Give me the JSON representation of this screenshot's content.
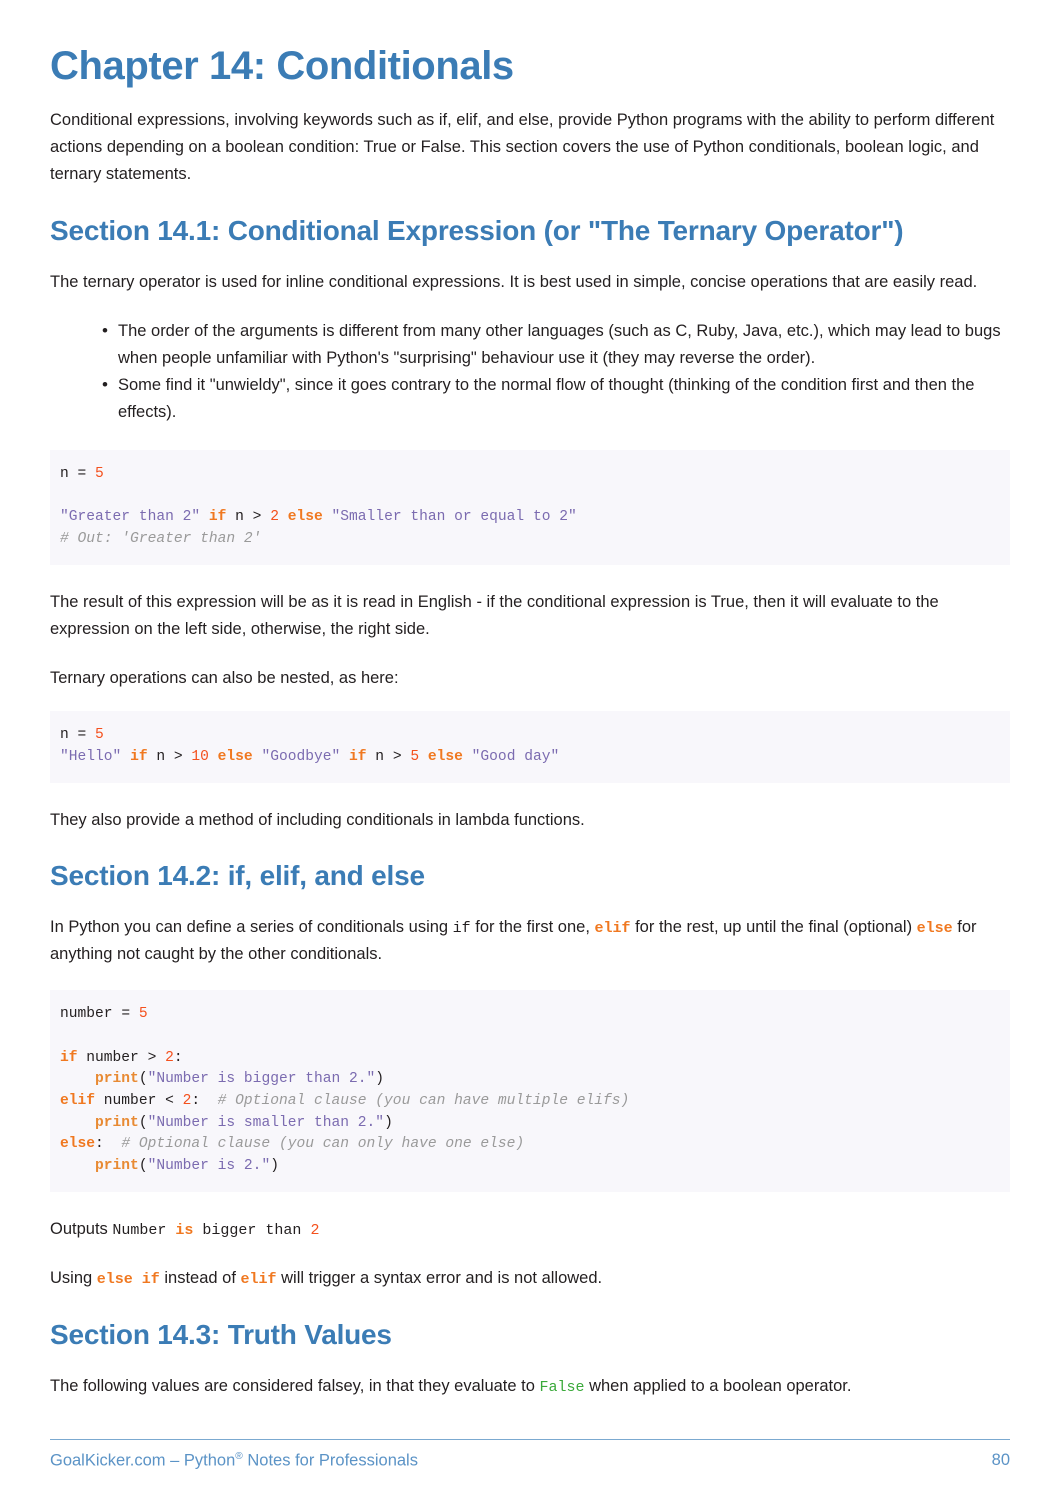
{
  "chapter": {
    "title": "Chapter 14: Conditionals",
    "intro": "Conditional expressions, involving keywords such as if, elif, and else, provide Python programs with the ability to perform different actions depending on a boolean condition: True or False. This section covers the use of Python conditionals, boolean logic, and ternary statements."
  },
  "section_141": {
    "heading": "Section 14.1: Conditional Expression (or \"The Ternary Operator\")",
    "para_1": "The ternary operator is used for inline conditional expressions. It is best used in simple, concise operations that are easily read.",
    "bullets": [
      "The order of the arguments is different from many other languages (such as C, Ruby, Java, etc.), which may lead to bugs when people unfamiliar with Python's \"surprising\" behaviour use it (they may reverse the order).",
      "Some find it \"unwieldy\", since it goes contrary to the normal flow of thought (thinking of the condition first and then the effects)."
    ],
    "code_1": {
      "line_1_var": "n ",
      "line_1_eq": "= ",
      "line_1_num": "5",
      "line_3_str1": "\"Greater than 2\" ",
      "line_3_if": "if",
      "line_3_mid": " n > ",
      "line_3_num": "2",
      "line_3_else": " else",
      "line_3_str2": " \"Smaller than or equal to 2\"",
      "line_4_comment": "# Out: 'Greater than 2'"
    },
    "para_2": "The result of this expression will be as it is read in English - if the conditional expression is True, then it will evaluate to the expression on the left side, otherwise, the right side.",
    "para_3": "Ternary operations can also be nested, as here:",
    "code_2": {
      "line_1_var": "n ",
      "line_1_eq": "= ",
      "line_1_num": "5",
      "line_2_str1": "\"Hello\" ",
      "line_2_if1": "if",
      "line_2_mid1": " n > ",
      "line_2_num1": "10",
      "line_2_else1": " else",
      "line_2_str2": " \"Goodbye\" ",
      "line_2_if2": "if",
      "line_2_mid2": " n > ",
      "line_2_num2": "5",
      "line_2_else2": " else",
      "line_2_str3": " \"Good day\""
    },
    "para_4": "They also provide a method of including conditionals in lambda functions."
  },
  "section_142": {
    "heading": "Section 14.2: if, elif, and else",
    "para_1_a": "In Python you can define a series of conditionals using ",
    "para_1_if": "if",
    "para_1_b": " for the first one, ",
    "para_1_elif": "elif",
    "para_1_c": " for the rest, up until the final (optional) ",
    "para_1_else": "else",
    "para_1_d": " for anything not caught by the other conditionals.",
    "code_3": {
      "l1_var": "number ",
      "l1_eq": "= ",
      "l1_num": "5",
      "l3_if": "if",
      "l3_mid": " number > ",
      "l3_num": "2",
      "l3_colon": ":",
      "l4_indent": "    ",
      "l4_fn": "print",
      "l4_open": "(",
      "l4_str": "\"Number is bigger than 2.\"",
      "l4_close": ")",
      "l5_elif": "elif",
      "l5_mid": " number < ",
      "l5_num": "2",
      "l5_colon": ":  ",
      "l5_comment": "# Optional clause (you can have multiple elifs)",
      "l6_indent": "    ",
      "l6_fn": "print",
      "l6_open": "(",
      "l6_str": "\"Number is smaller than 2.\"",
      "l6_close": ")",
      "l7_else": "else",
      "l7_colon": ":  ",
      "l7_comment": "# Optional clause (you can only have one else)",
      "l8_indent": "    ",
      "l8_fn": "print",
      "l8_open": "(",
      "l8_str": "\"Number is 2.\"",
      "l8_close": ")"
    },
    "outputs_label": "Outputs ",
    "outputs_code_a": "Number ",
    "outputs_code_is": "is",
    "outputs_code_b": " bigger than ",
    "outputs_code_num": "2",
    "para_2_a": "Using ",
    "para_2_elseif": "else if",
    "para_2_b": " instead of ",
    "para_2_elif": "elif",
    "para_2_c": " will trigger a syntax error and is not allowed."
  },
  "section_143": {
    "heading": "Section 14.3: Truth Values",
    "para_1_a": "The following values are considered falsey, in that they evaluate to ",
    "para_1_false": "False",
    "para_1_b": " when applied to a boolean operator."
  },
  "footer": {
    "site": "GoalKicker.com – Python",
    "reg": "®",
    "title": " Notes for Professionals",
    "page_number": "80"
  },
  "colors": {
    "heading_blue": "#3b7cb5",
    "footer_blue": "#5b93c6",
    "code_bg": "#f8f7fb",
    "keyword_orange": "#f07820",
    "number_orange": "#f4511e",
    "string_purple": "#7b6bb0",
    "comment_gray": "#9a9a9a",
    "function_orange": "#e88a33",
    "bool_green": "#3aa93a",
    "body_text": "#231f20"
  }
}
